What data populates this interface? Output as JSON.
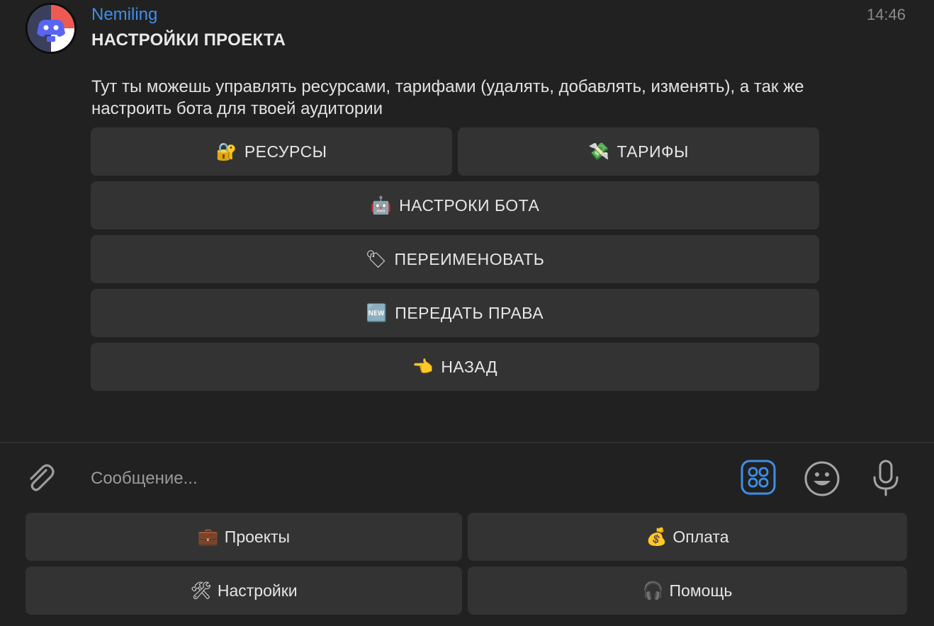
{
  "message": {
    "sender": "Nemiling",
    "time": "14:46",
    "title": "НАСТРОЙКИ ПРОЕКТА",
    "body": "Тут ты можешь управлять ресурсами, тарифами (удалять, добавлять, изменять), а так же настроить бота для твоей аудитории"
  },
  "inline_keyboard": {
    "resources": {
      "icon": "locked-with-key-icon",
      "emoji": "🔐",
      "label": "РЕСУРСЫ"
    },
    "tariffs": {
      "icon": "money-with-wings-icon",
      "emoji": "💸",
      "label": "ТАРИФЫ"
    },
    "bot_settings": {
      "icon": "robot-icon",
      "emoji": "🤖",
      "label": "НАСТРОКИ БОТА"
    },
    "rename": {
      "icon": "label-tag-icon",
      "emoji": "🏷",
      "label": "ПЕРЕИМЕНОВАТЬ"
    },
    "transfer_rights": {
      "icon": "new-button-icon",
      "emoji": "🆕",
      "label": "ПЕРЕДАТЬ ПРАВА"
    },
    "back": {
      "icon": "pointing-left-icon",
      "emoji": "👈",
      "label": "НАЗАД"
    }
  },
  "composer": {
    "placeholder": "Сообщение...",
    "attach_icon": "paperclip-icon",
    "keyboard_icon": "keyboard-toggle-icon",
    "emoji_icon": "smiley-icon",
    "mic_icon": "microphone-icon",
    "accent_color": "#3e8fe8"
  },
  "reply_keyboard": {
    "projects": {
      "icon": "briefcase-icon",
      "emoji": "💼",
      "label": "Проекты"
    },
    "payment": {
      "icon": "money-bag-icon",
      "emoji": "💰",
      "label": "Оплата"
    },
    "settings": {
      "icon": "hammer-and-wrench-icon",
      "emoji": "🛠",
      "label": "Настройки"
    },
    "help": {
      "icon": "headphones-icon",
      "emoji": "🎧",
      "label": "Помощь"
    }
  },
  "colors": {
    "background": "#212121",
    "button": "#333333",
    "sender_name": "#3e8fe8",
    "avatar_red": "#ee5a52"
  }
}
